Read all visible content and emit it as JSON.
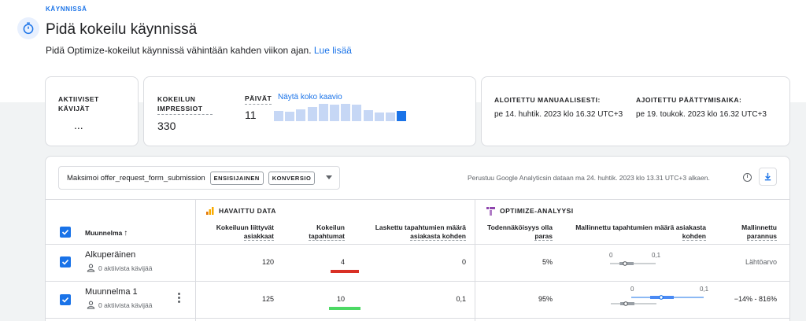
{
  "header": {
    "status": "KÄYNNISSÄ",
    "title": "Pidä kokeilu käynnissä",
    "subtitle": "Pidä Optimize-kokeilut käynnissä vähintään kahden viikon ajan.",
    "learn_more": "Lue lisää"
  },
  "cards": {
    "active_visitors_label": "AKTIIVISET KÄVIJÄT",
    "active_visitors_value": "...",
    "impressions_label": "KOKEILUN IMPRESSIOT",
    "impressions_value": "330",
    "days_label": "PÄIVÄT",
    "days_value": "11",
    "show_chart_link": "Näytä koko kaavio",
    "day_bars": [
      0.6,
      0.55,
      0.7,
      0.8,
      1.0,
      0.95,
      0.98,
      0.95,
      0.62,
      0.5,
      0.5,
      0.58
    ],
    "manual_start_label": "ALOITETTU MANUAALISESTI:",
    "manual_start_value": "pe 14. huhtik. 2023 klo 16.32 UTC+3",
    "scheduled_end_label": "AJOITETTU PÄÄTTYMISAIKA:",
    "scheduled_end_value": "pe 19. toukok. 2023 klo 16.32 UTC+3"
  },
  "toolbar": {
    "objective": "Maksimoi offer_request_form_submission",
    "chip_primary": "ENSISIJAINEN",
    "chip_conversion": "KONVERSIO",
    "analytics_note": "Perustuu Google Analyticsin dataan ma 24. huhtik. 2023 klo 13.31 UTC+3 alkaen."
  },
  "table": {
    "group_observed": "HAVAITTU DATA",
    "group_optimize": "OPTIMIZE-ANALYYSI",
    "col_variant": "Muunnelma",
    "sort_arrow": "↑",
    "col_users": [
      "Kokeiluun liittyvät",
      "asiakkaat"
    ],
    "col_events": [
      "Kokeilun",
      "tapahtumat"
    ],
    "col_rate": [
      "Laskettu tapahtumien määrä",
      "asiakasta kohden"
    ],
    "col_prob": [
      "Todennäköisyys olla",
      "paras"
    ],
    "col_modeled": [
      "Mallinnettu tapahtumien määrä asiakasta",
      "kohden"
    ],
    "col_improve": [
      "Mallinnettu",
      "parannus"
    ],
    "rows": [
      {
        "name": "Alkuperäinen",
        "active": "0 aktiivista kävijää",
        "users": "120",
        "events": "4",
        "rate": "0",
        "prob": "5%",
        "axis_min": "0",
        "axis_max": "0,1",
        "improvement": "Lähtöarvo",
        "event_color": "#d93025"
      },
      {
        "name": "Muunnelma 1",
        "active": "0 aktiivista kävijää",
        "users": "125",
        "events": "10",
        "rate": "0,1",
        "prob": "95%",
        "axis_min": "0",
        "axis_max": "0,1",
        "improvement": "−14% - 816%",
        "event_color": "#4cd964"
      }
    ]
  },
  "colors": {
    "accent": "#1a73e8",
    "analytics_orange": "#f9ab00",
    "optimize_purple": "#8e44ad"
  }
}
